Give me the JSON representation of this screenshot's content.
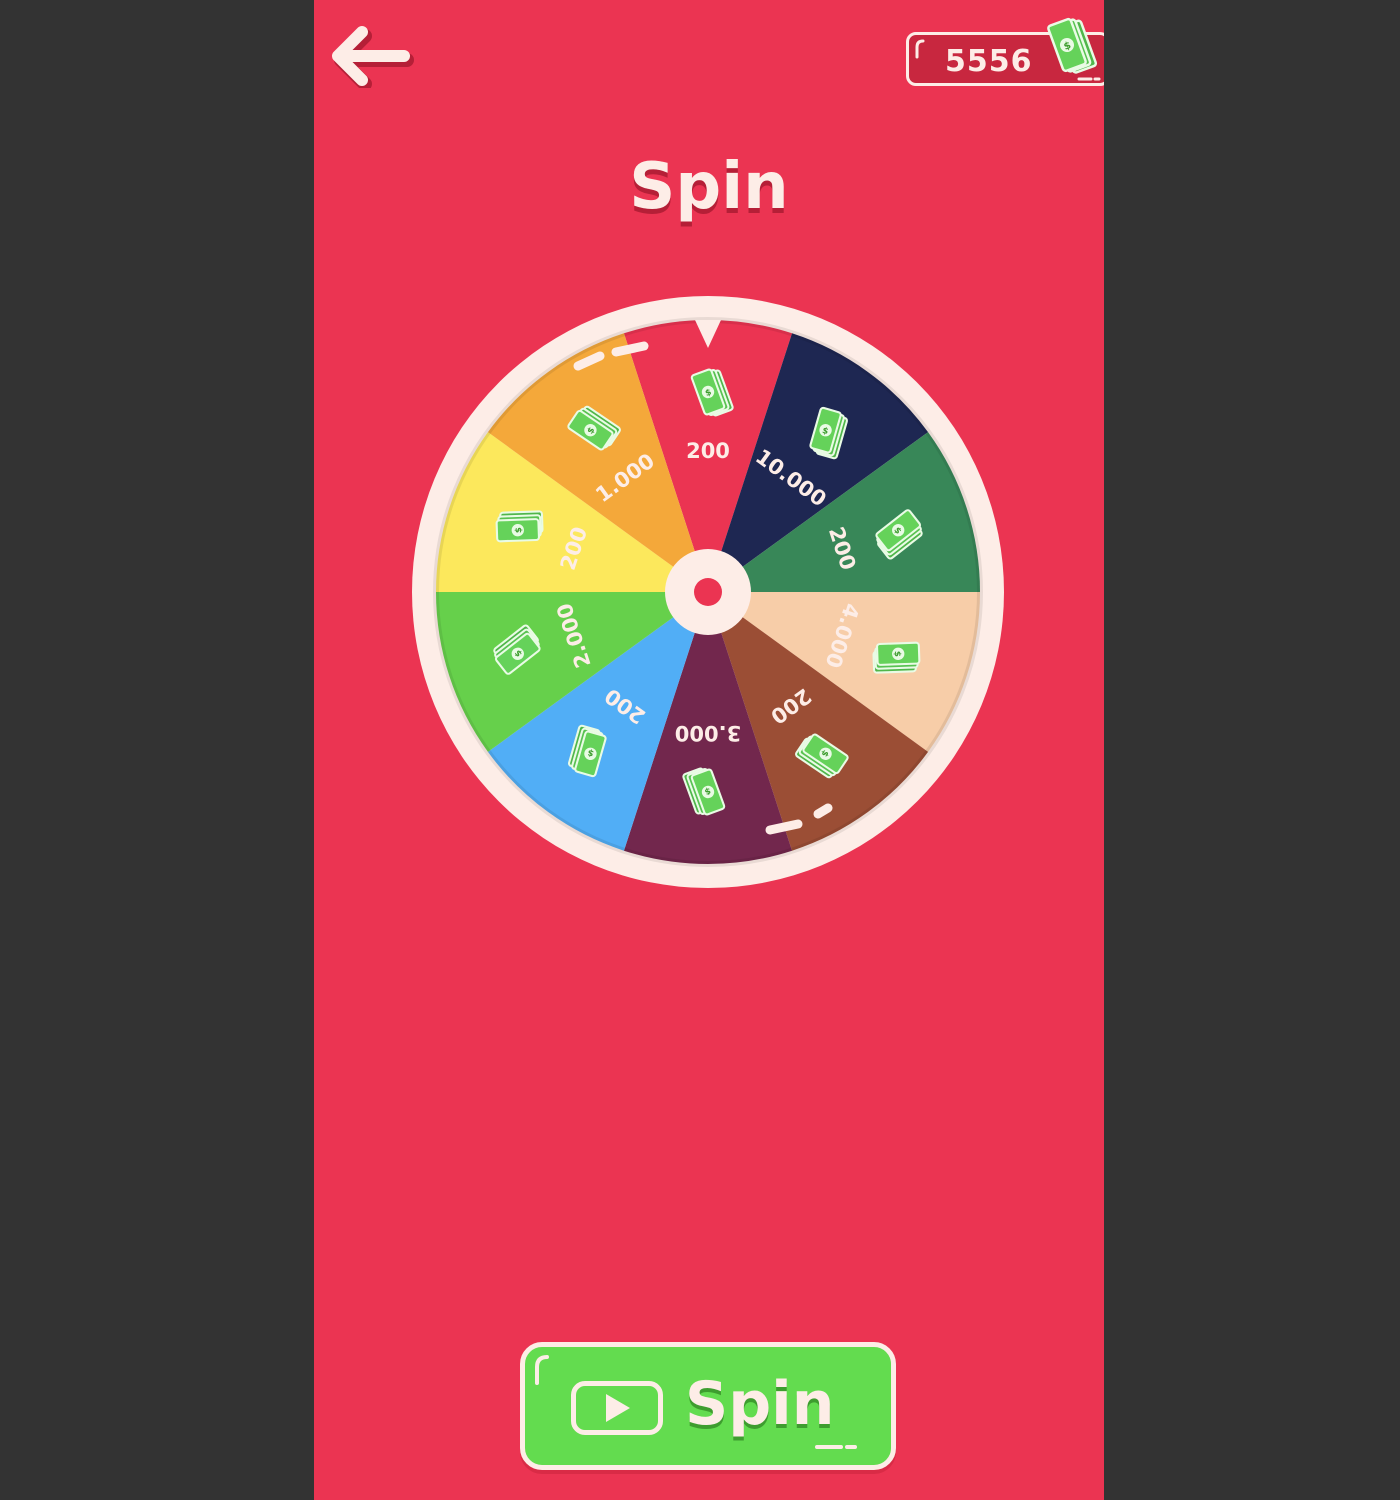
{
  "header": {
    "back_icon": "left-arrow-icon",
    "cash_value": "5556",
    "cash_icon": "cash-stack-icon"
  },
  "title": "Spin",
  "wheel": {
    "pointer_icon": "wheel-pointer-icon",
    "segment_icon": "cash-stack-icon",
    "segments": [
      {
        "label": "200",
        "color": "#EB3452"
      },
      {
        "label": "10.000",
        "color": "#1E2752"
      },
      {
        "label": "200",
        "color": "#388758"
      },
      {
        "label": "4.000",
        "color": "#F7CDA8"
      },
      {
        "label": "200",
        "color": "#9B4E35"
      },
      {
        "label": "3.000",
        "color": "#72274D"
      },
      {
        "label": "200",
        "color": "#51AEF6"
      },
      {
        "label": "2.000",
        "color": "#66D04B"
      },
      {
        "label": "200",
        "color": "#FCE85C"
      },
      {
        "label": "1.000",
        "color": "#F4A83A"
      }
    ]
  },
  "spin_button": {
    "label": "Spin",
    "icon": "play-video-icon"
  },
  "colors": {
    "background": "#EB3452",
    "side_bars": "#333333",
    "cream": "#FDEDE7",
    "button_green": "#63DC4F",
    "cash_green": "#65D25A"
  }
}
